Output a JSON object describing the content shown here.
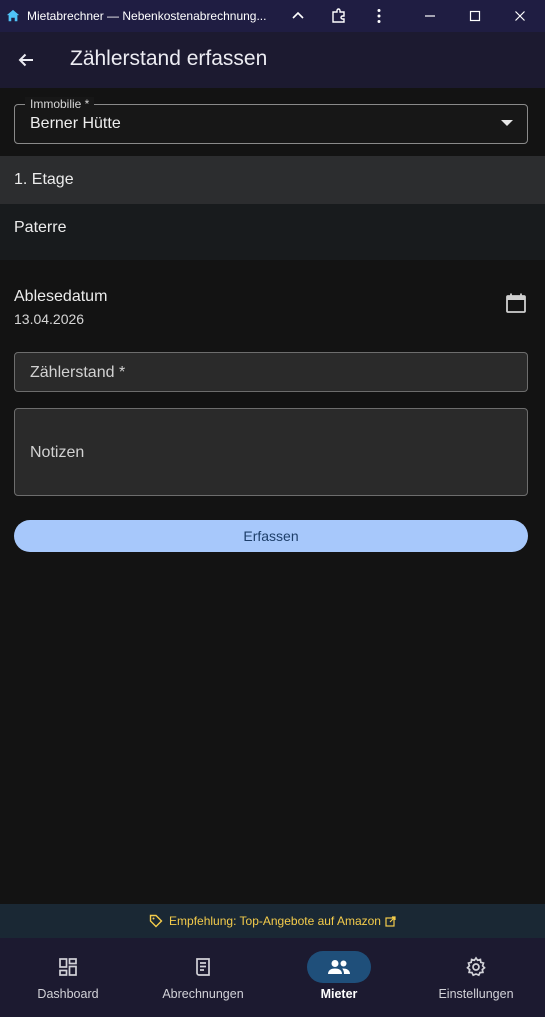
{
  "window": {
    "title": "Mietabrechner — Nebenkostenabrechnung...",
    "icons": [
      "home-app-icon",
      "chevron-up-icon",
      "extension-icon",
      "more-vert-icon",
      "minimize-icon",
      "maximize-icon",
      "close-icon"
    ]
  },
  "appbar": {
    "title": "Zählerstand erfassen",
    "back_icon": "arrow-left-icon"
  },
  "property": {
    "label": "Immobilie *",
    "value": "Berner Hütte"
  },
  "floors": [
    {
      "label": "1. Etage",
      "selected": true
    },
    {
      "label": "Paterre",
      "selected": false
    }
  ],
  "reading_date": {
    "label": "Ablesedatum",
    "value": "13.04.2026",
    "icon": "calendar-icon"
  },
  "meter_field": {
    "placeholder": "Zählerstand *"
  },
  "notes_field": {
    "placeholder": "Notizen"
  },
  "submit": {
    "label": "Erfassen"
  },
  "ad": {
    "text": "Empfehlung: Top-Angebote auf Amazon",
    "color": "#f4cc4b"
  },
  "nav": [
    {
      "label": "Dashboard",
      "icon": "dashboard-icon",
      "active": false
    },
    {
      "label": "Abrechnungen",
      "icon": "receipt-icon",
      "active": false
    },
    {
      "label": "Mieter",
      "icon": "people-icon",
      "active": true
    },
    {
      "label": "Einstellungen",
      "icon": "gear-icon",
      "active": false
    }
  ],
  "colors": {
    "accent": "#a7c8fb",
    "nav_active": "#1f4f7a",
    "titlebar": "#1f1d42",
    "appbar": "#1c1a30"
  }
}
